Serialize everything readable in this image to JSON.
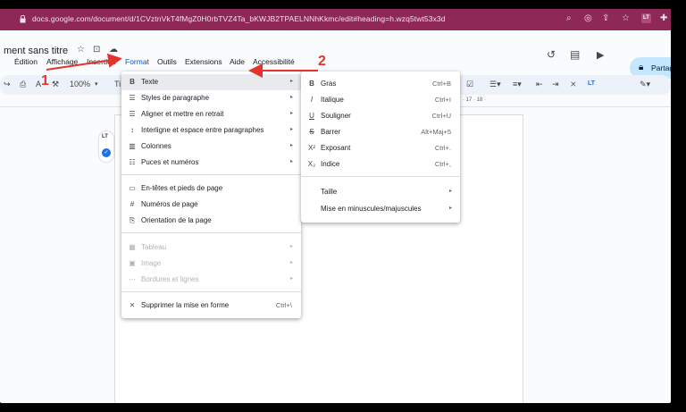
{
  "browser": {
    "url": "docs.google.com/document/d/1CVztnVkT4fMgZ0H0rbTVZ4Ta_bKWJB2TPAELNNhKkmc/edit#heading=h.wzq5twt53x3d",
    "extension_badge": "LT"
  },
  "document": {
    "title": "ment sans titre",
    "share_label": "Partage"
  },
  "menubar": {
    "items": [
      "Édition",
      "Affichage",
      "Insertion",
      "Format",
      "Outils",
      "Extensions",
      "Aide",
      "Accessibilité"
    ],
    "active": "Format"
  },
  "toolbar": {
    "zoom": "100%",
    "font_initial": "Ti"
  },
  "ruler_marks": "·  17  ·  18  ·",
  "lt_widget": {
    "logo": "LT"
  },
  "format_menu": {
    "items": [
      {
        "icon": "B",
        "label": "Texte",
        "submenu": true,
        "highlighted": true
      },
      {
        "icon": "☰",
        "label": "Styles de paragraphe",
        "submenu": true
      },
      {
        "icon": "☰",
        "label": "Aligner et mettre en retrait",
        "submenu": true
      },
      {
        "icon": "↕",
        "label": "Interligne et espace entre paragraphes",
        "submenu": true
      },
      {
        "icon": "▥",
        "label": "Colonnes",
        "submenu": true
      },
      {
        "icon": "☷",
        "label": "Puces et numéros",
        "submenu": true
      },
      {
        "icon": "▭",
        "label": "En-têtes et pieds de page",
        "submenu": false
      },
      {
        "icon": "#",
        "label": "Numéros de page",
        "submenu": false
      },
      {
        "icon": "⎘",
        "label": "Orientation de la page",
        "submenu": false
      },
      {
        "icon": "▦",
        "label": "Tableau",
        "submenu": true,
        "disabled": true
      },
      {
        "icon": "▣",
        "label": "Image",
        "submenu": true,
        "disabled": true
      },
      {
        "icon": "⋯",
        "label": "Bordures et lignes",
        "submenu": true,
        "disabled": true
      },
      {
        "icon": "⨯",
        "label": "Supprimer la mise en forme",
        "shortcut": "Ctrl+\\"
      }
    ]
  },
  "text_menu": {
    "items": [
      {
        "icon": "B",
        "label": "Gras",
        "shortcut": "Ctrl+B"
      },
      {
        "icon": "I",
        "label": "Italique",
        "shortcut": "Ctrl+I"
      },
      {
        "icon": "U",
        "label": "Souligner",
        "shortcut": "Ctrl+U"
      },
      {
        "icon": "S",
        "label": "Barrer",
        "shortcut": "Alt+Maj+5"
      },
      {
        "icon": "X²",
        "label": "Exposant",
        "shortcut": "Ctrl+."
      },
      {
        "icon": "X₂",
        "label": "Indice",
        "shortcut": "Ctrl+,"
      },
      {
        "icon": "",
        "label": "Taille",
        "submenu": true
      },
      {
        "icon": "",
        "label": "Mise en minuscules/majuscules",
        "submenu": true
      }
    ]
  },
  "annotations": {
    "step1": "1",
    "step2": "2",
    "color": "#e5322d"
  },
  "colors": {
    "browser_bar": "#8d2857",
    "share_button": "#c2e7ff",
    "menu_highlight": "#e8eaed"
  }
}
